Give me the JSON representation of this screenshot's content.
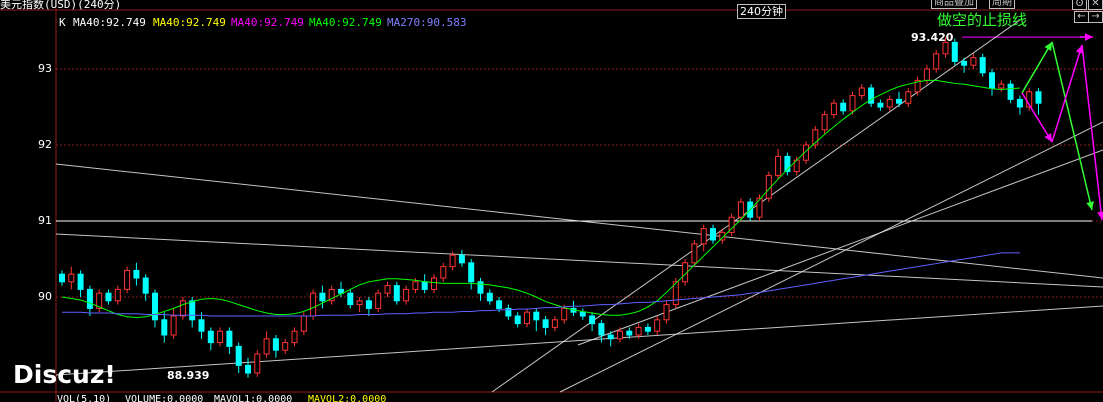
{
  "header": {
    "symbol_title": "美元指数(USD)(240分)",
    "k_label": "K",
    "ma_items": [
      {
        "text": "MA40:92.749",
        "color": "#ffffff"
      },
      {
        "text": "MA40:92.749",
        "color": "#ffff00"
      },
      {
        "text": "MA40:92.749",
        "color": "#ff00ff"
      },
      {
        "text": "MA40:92.749",
        "color": "#00ff00"
      },
      {
        "text": "MA270:90.583",
        "color": "#8080ff"
      }
    ],
    "period_box": "240分钟",
    "overlay_button": "商品叠加",
    "cycle_button": "周期",
    "window_buttons": [
      "ʘ",
      "✕"
    ],
    "nav_buttons": [
      "←",
      "→"
    ]
  },
  "annotation": {
    "text": "做空的止损线",
    "color": "#33ff33"
  },
  "footer": {
    "vol_label": "VOL(5,10)",
    "volume": "VOLUME:0.0000",
    "mavol1": "MAVOL1:0.0000",
    "mavol2": "MAVOL2:0.0000"
  },
  "watermark": "Discuz!",
  "chart_data": {
    "type": "candlestick",
    "title": "美元指数(USD)(240分)",
    "xlabel": "",
    "ylabel": "",
    "ylim": [
      88.9,
      93.6
    ],
    "yticks": [
      90.0,
      91.0,
      92.0,
      93.0
    ],
    "grid": true,
    "colors": {
      "up": "#ff3333",
      "down": "#00ffff",
      "ma40": "#00ff00",
      "ma270": "#6060ff"
    },
    "labels": [
      {
        "text": "93.420",
        "value": 93.42
      },
      {
        "text": "88.939",
        "value": 88.939
      }
    ],
    "levels": [
      {
        "value": 91.0,
        "color": "#ffffff"
      },
      {
        "value": 93.42,
        "color": "#ff00ff"
      }
    ],
    "candles": [
      [
        90.3,
        90.2,
        90.35,
        90.15
      ],
      [
        90.2,
        90.3,
        90.4,
        90.1
      ],
      [
        90.3,
        90.1,
        90.35,
        90.0
      ],
      [
        90.1,
        89.85,
        90.15,
        89.75
      ],
      [
        89.85,
        90.05,
        90.1,
        89.8
      ],
      [
        90.05,
        89.95,
        90.1,
        89.9
      ],
      [
        89.95,
        90.1,
        90.15,
        89.9
      ],
      [
        90.1,
        90.35,
        90.4,
        90.05
      ],
      [
        90.35,
        90.25,
        90.45,
        90.15
      ],
      [
        90.25,
        90.05,
        90.3,
        89.95
      ],
      [
        90.05,
        89.7,
        90.1,
        89.6
      ],
      [
        89.7,
        89.5,
        89.8,
        89.4
      ],
      [
        89.5,
        89.75,
        89.85,
        89.45
      ],
      [
        89.75,
        89.95,
        90.0,
        89.7
      ],
      [
        89.95,
        89.7,
        90.0,
        89.6
      ],
      [
        89.7,
        89.55,
        89.8,
        89.45
      ],
      [
        89.55,
        89.4,
        89.6,
        89.3
      ],
      [
        89.4,
        89.55,
        89.6,
        89.35
      ],
      [
        89.55,
        89.35,
        89.6,
        89.25
      ],
      [
        89.35,
        89.1,
        89.4,
        89.0
      ],
      [
        89.1,
        89.0,
        89.2,
        88.94
      ],
      [
        89.0,
        89.25,
        89.3,
        88.95
      ],
      [
        89.25,
        89.45,
        89.55,
        89.2
      ],
      [
        89.45,
        89.3,
        89.5,
        89.2
      ],
      [
        89.3,
        89.4,
        89.45,
        89.25
      ],
      [
        89.4,
        89.55,
        89.6,
        89.35
      ],
      [
        89.55,
        89.75,
        89.8,
        89.5
      ],
      [
        89.75,
        90.05,
        90.1,
        89.7
      ],
      [
        90.05,
        89.95,
        90.15,
        89.85
      ],
      [
        89.95,
        90.1,
        90.15,
        89.9
      ],
      [
        90.1,
        90.05,
        90.2,
        90.0
      ],
      [
        90.05,
        89.9,
        90.1,
        89.85
      ],
      [
        89.9,
        89.95,
        90.0,
        89.8
      ],
      [
        89.95,
        89.85,
        90.0,
        89.75
      ],
      [
        89.85,
        90.05,
        90.1,
        89.8
      ],
      [
        90.05,
        90.15,
        90.2,
        90.0
      ],
      [
        90.15,
        89.95,
        90.2,
        89.9
      ],
      [
        89.95,
        90.1,
        90.15,
        89.9
      ],
      [
        90.1,
        90.2,
        90.25,
        90.05
      ],
      [
        90.2,
        90.1,
        90.3,
        90.05
      ],
      [
        90.1,
        90.25,
        90.3,
        90.05
      ],
      [
        90.25,
        90.4,
        90.45,
        90.2
      ],
      [
        90.4,
        90.55,
        90.6,
        90.35
      ],
      [
        90.55,
        90.45,
        90.62,
        90.4
      ],
      [
        90.45,
        90.2,
        90.5,
        90.1
      ],
      [
        90.2,
        90.05,
        90.25,
        89.95
      ],
      [
        90.05,
        89.95,
        90.1,
        89.9
      ],
      [
        89.95,
        89.85,
        90.0,
        89.8
      ],
      [
        89.85,
        89.75,
        89.9,
        89.7
      ],
      [
        89.75,
        89.65,
        89.8,
        89.6
      ],
      [
        89.65,
        89.8,
        89.85,
        89.6
      ],
      [
        89.8,
        89.7,
        89.85,
        89.55
      ],
      [
        89.7,
        89.6,
        89.75,
        89.5
      ],
      [
        89.6,
        89.7,
        89.75,
        89.55
      ],
      [
        89.7,
        89.85,
        89.9,
        89.65
      ],
      [
        89.85,
        89.8,
        89.95,
        89.75
      ],
      [
        89.8,
        89.75,
        89.85,
        89.7
      ],
      [
        89.75,
        89.65,
        89.8,
        89.55
      ],
      [
        89.65,
        89.5,
        89.7,
        89.4
      ],
      [
        89.5,
        89.45,
        89.55,
        89.35
      ],
      [
        89.45,
        89.55,
        89.6,
        89.4
      ],
      [
        89.55,
        89.5,
        89.6,
        89.45
      ],
      [
        89.5,
        89.6,
        89.65,
        89.45
      ],
      [
        89.6,
        89.55,
        89.65,
        89.5
      ],
      [
        89.55,
        89.7,
        89.75,
        89.5
      ],
      [
        89.7,
        89.9,
        89.95,
        89.65
      ],
      [
        89.9,
        90.2,
        90.25,
        89.85
      ],
      [
        90.2,
        90.45,
        90.5,
        90.15
      ],
      [
        90.45,
        90.7,
        90.75,
        90.4
      ],
      [
        90.7,
        90.9,
        90.95,
        90.6
      ],
      [
        90.9,
        90.75,
        90.95,
        90.7
      ],
      [
        90.75,
        90.85,
        90.9,
        90.7
      ],
      [
        90.85,
        91.05,
        91.1,
        90.8
      ],
      [
        91.05,
        91.25,
        91.3,
        91.0
      ],
      [
        91.25,
        91.05,
        91.3,
        91.0
      ],
      [
        91.05,
        91.3,
        91.35,
        91.0
      ],
      [
        91.3,
        91.6,
        91.65,
        91.25
      ],
      [
        91.6,
        91.85,
        91.95,
        91.55
      ],
      [
        91.85,
        91.65,
        91.9,
        91.6
      ],
      [
        91.65,
        91.8,
        91.85,
        91.6
      ],
      [
        91.8,
        92.0,
        92.05,
        91.75
      ],
      [
        92.0,
        92.2,
        92.25,
        91.95
      ],
      [
        92.2,
        92.4,
        92.45,
        92.15
      ],
      [
        92.4,
        92.55,
        92.6,
        92.35
      ],
      [
        92.55,
        92.45,
        92.6,
        92.4
      ],
      [
        92.45,
        92.65,
        92.7,
        92.4
      ],
      [
        92.65,
        92.75,
        92.8,
        92.6
      ],
      [
        92.75,
        92.55,
        92.8,
        92.5
      ],
      [
        92.55,
        92.5,
        92.6,
        92.45
      ],
      [
        92.5,
        92.6,
        92.65,
        92.45
      ],
      [
        92.6,
        92.55,
        92.7,
        92.5
      ],
      [
        92.55,
        92.7,
        92.75,
        92.5
      ],
      [
        92.7,
        92.85,
        92.9,
        92.65
      ],
      [
        92.85,
        93.0,
        93.05,
        92.8
      ],
      [
        93.0,
        93.2,
        93.25,
        92.95
      ],
      [
        93.2,
        93.35,
        93.42,
        93.15
      ],
      [
        93.35,
        93.1,
        93.4,
        93.05
      ],
      [
        93.1,
        93.05,
        93.15,
        92.95
      ],
      [
        93.05,
        93.15,
        93.2,
        93.0
      ],
      [
        93.15,
        92.95,
        93.2,
        92.9
      ],
      [
        92.95,
        92.75,
        93.0,
        92.65
      ],
      [
        92.75,
        92.8,
        92.85,
        92.7
      ],
      [
        92.8,
        92.6,
        92.85,
        92.55
      ],
      [
        92.6,
        92.5,
        92.65,
        92.4
      ],
      [
        92.5,
        92.7,
        92.75,
        92.45
      ],
      [
        92.7,
        92.55,
        92.75,
        92.4
      ]
    ],
    "series": [
      {
        "name": "MA40",
        "values": [
          90.0,
          89.98,
          89.96,
          89.92,
          89.87,
          89.82,
          89.77,
          89.74,
          89.73,
          89.74,
          89.77,
          89.81,
          89.85,
          89.9,
          89.94,
          89.97,
          89.98,
          89.97,
          89.94,
          89.9,
          89.86,
          89.82,
          89.79,
          89.77,
          89.77,
          89.78,
          89.81,
          89.86,
          89.92,
          89.98,
          90.04,
          90.1,
          90.16,
          90.2,
          90.22,
          90.24,
          90.24,
          90.23,
          90.22,
          90.2,
          90.19,
          90.18,
          90.18,
          90.18,
          90.18,
          90.17,
          90.16,
          90.14,
          90.12,
          90.09,
          90.05,
          90.0,
          89.94,
          89.9,
          89.86,
          89.83,
          89.81,
          89.79,
          89.77,
          89.76,
          89.76,
          89.78,
          89.81,
          89.87,
          89.95,
          90.06,
          90.18,
          90.3,
          90.42,
          90.54,
          90.66,
          90.78,
          90.9,
          91.02,
          91.15,
          91.28,
          91.42,
          91.55,
          91.68,
          91.8,
          91.92,
          92.03,
          92.14,
          92.24,
          92.34,
          92.43,
          92.52,
          92.6,
          92.66,
          92.72,
          92.77,
          92.8,
          92.83,
          92.85,
          92.85,
          92.83,
          92.81,
          92.8,
          92.78,
          92.76,
          92.74,
          92.73,
          92.74,
          92.75
        ]
      },
      {
        "name": "MA270",
        "values": [
          89.8,
          89.8,
          89.8,
          89.79,
          89.79,
          89.79,
          89.78,
          89.78,
          89.78,
          89.77,
          89.77,
          89.77,
          89.76,
          89.76,
          89.76,
          89.76,
          89.75,
          89.75,
          89.75,
          89.75,
          89.75,
          89.75,
          89.75,
          89.75,
          89.75,
          89.75,
          89.75,
          89.75,
          89.76,
          89.76,
          89.76,
          89.76,
          89.77,
          89.77,
          89.77,
          89.78,
          89.78,
          89.78,
          89.79,
          89.79,
          89.8,
          89.8,
          89.8,
          89.81,
          89.81,
          89.82,
          89.82,
          89.83,
          89.83,
          89.84,
          89.84,
          89.85,
          89.86,
          89.86,
          89.87,
          89.88,
          89.88,
          89.89,
          89.9,
          89.9,
          89.91,
          89.92,
          89.93,
          89.93,
          89.94,
          89.95,
          89.96,
          89.97,
          89.98,
          89.99,
          90.0,
          90.01,
          90.02,
          90.03,
          90.05,
          90.06,
          90.08,
          90.1,
          90.12,
          90.14,
          90.16,
          90.18,
          90.2,
          90.22,
          90.24,
          90.26,
          90.28,
          90.3,
          90.32,
          90.34,
          90.36,
          90.38,
          90.4,
          90.42,
          90.44,
          90.46,
          90.48,
          90.5,
          90.52,
          90.54,
          90.56,
          90.58,
          90.58,
          90.58
        ]
      }
    ]
  }
}
